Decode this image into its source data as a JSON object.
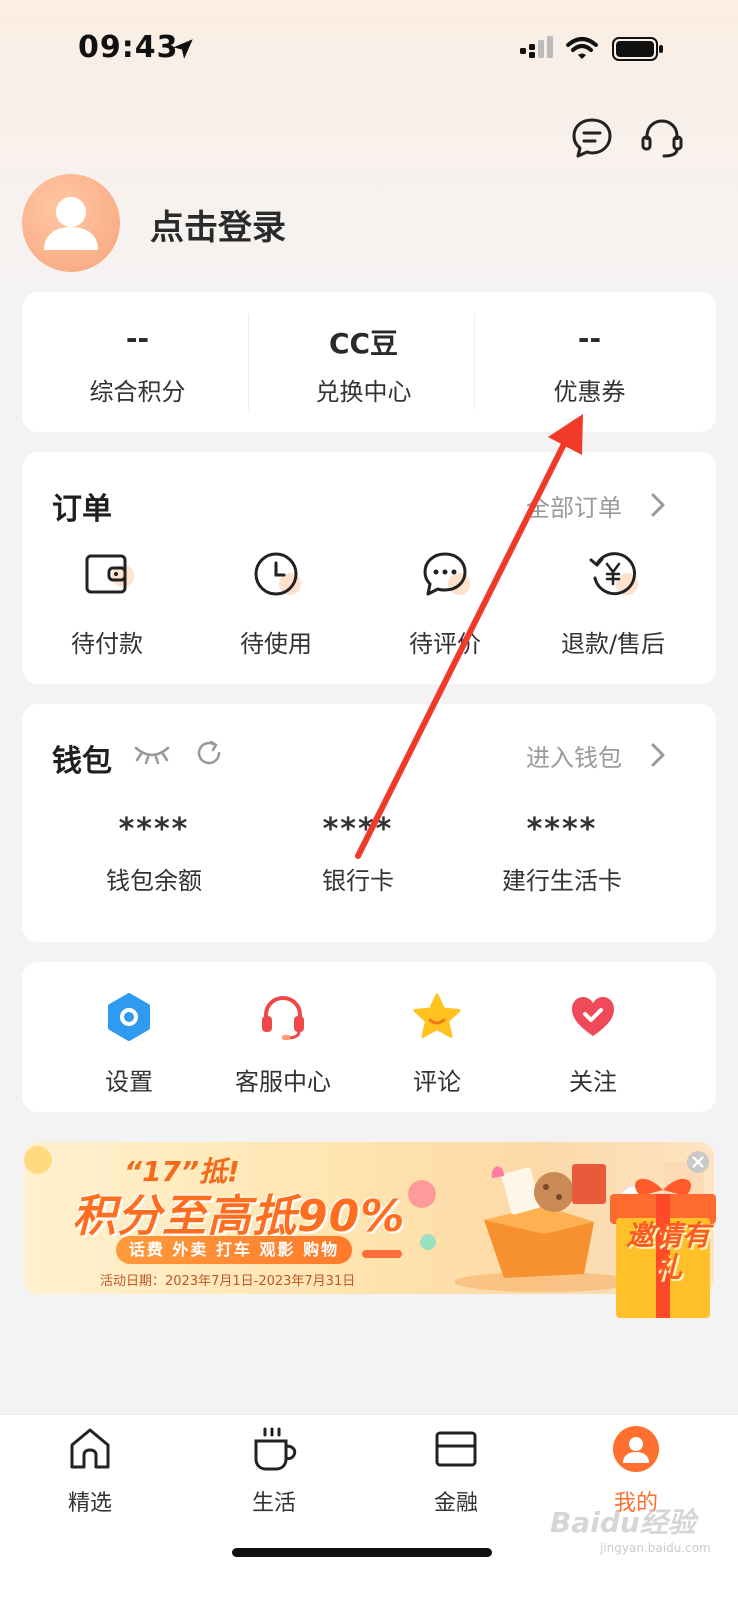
{
  "status_bar": {
    "time": "09:43"
  },
  "profile": {
    "login_text": "点击登录"
  },
  "stats": [
    {
      "value": "--",
      "label": "综合积分"
    },
    {
      "value": "CC豆",
      "label": "兑换中心"
    },
    {
      "value": "--",
      "label": "优惠券"
    }
  ],
  "orders": {
    "title": "订单",
    "link": "全部订单",
    "items": [
      {
        "label": "待付款",
        "icon": "wallet-icon"
      },
      {
        "label": "待使用",
        "icon": "clock-icon"
      },
      {
        "label": "待评价",
        "icon": "chat-bubble-icon"
      },
      {
        "label": "退款/售后",
        "icon": "refund-icon"
      }
    ]
  },
  "wallet": {
    "title": "钱包",
    "link": "进入钱包",
    "items": [
      {
        "value": "****",
        "label": "钱包余额"
      },
      {
        "value": "****",
        "label": "银行卡"
      },
      {
        "value": "****",
        "label": "建行生活卡"
      }
    ]
  },
  "shortcuts": [
    {
      "label": "设置",
      "icon": "settings-icon"
    },
    {
      "label": "客服中心",
      "icon": "headset-icon"
    },
    {
      "label": "评论",
      "icon": "star-icon"
    },
    {
      "label": "关注",
      "icon": "heart-icon"
    }
  ],
  "banner": {
    "tag": "“17”抵!",
    "headline": "积分至高抵90%",
    "pill": "话费 外卖 打车 观影 购物",
    "date": "活动日期：2023年7月1日-2023年7月31日",
    "invite": "邀请有礼"
  },
  "tabbar": [
    {
      "label": "精选",
      "icon": "home-icon",
      "active": false
    },
    {
      "label": "生活",
      "icon": "cup-icon",
      "active": false
    },
    {
      "label": "金融",
      "icon": "card-icon",
      "active": false
    },
    {
      "label": "我的",
      "icon": "profile-icon",
      "active": true
    }
  ],
  "watermark": {
    "brand": "Baidu经验",
    "url": "jingyan.baidu.com"
  },
  "colors": {
    "accent": "#ff6f2e",
    "annotation_arrow": "#f23a2a",
    "background": "#f4f3f3"
  }
}
